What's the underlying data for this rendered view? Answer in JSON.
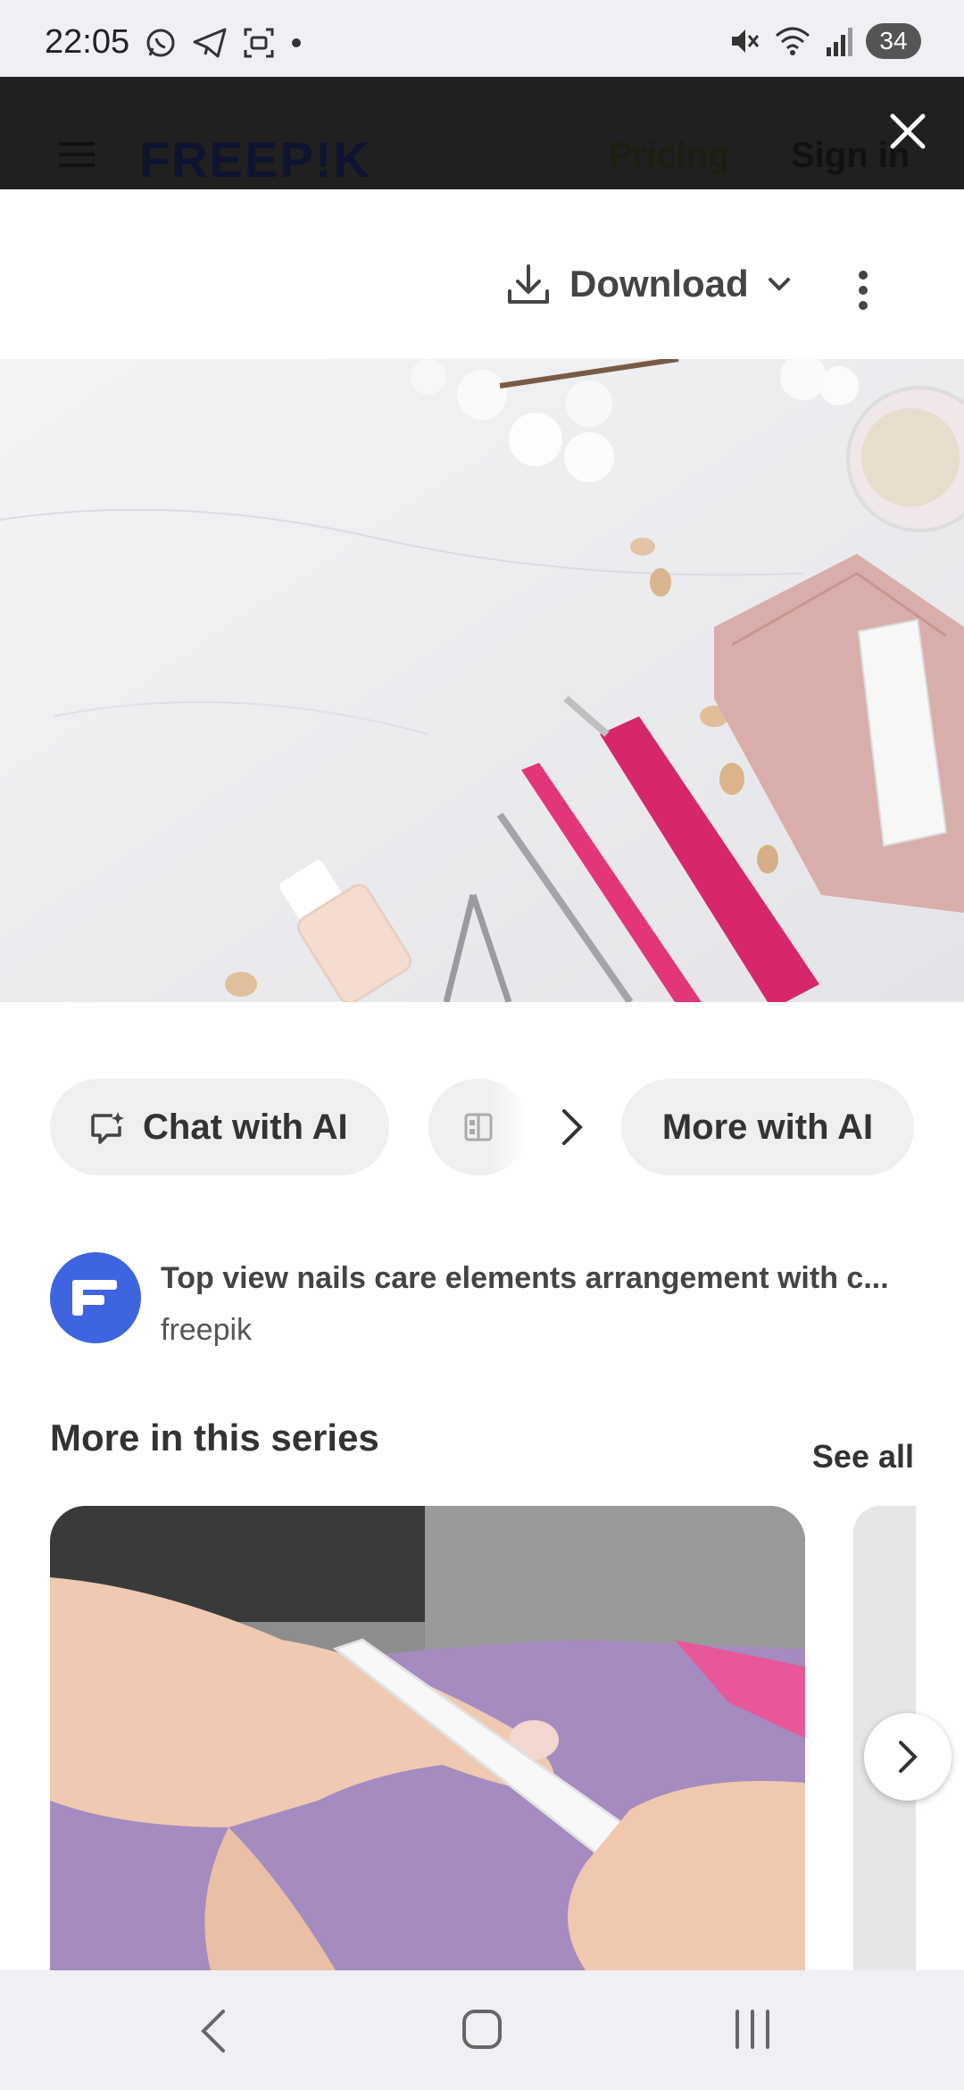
{
  "status_bar": {
    "time": "22:05",
    "battery": "34",
    "left_icons": [
      "whatsapp-icon",
      "telegram-icon",
      "screenshot-icon",
      "dot-icon"
    ],
    "right_icons": [
      "mute-icon",
      "wifi-icon",
      "signal-icon"
    ]
  },
  "header": {
    "brand": "FREEP!K",
    "pricing": "Pricing",
    "sign_in": "Sign in"
  },
  "toolbar": {
    "download_label": "Download"
  },
  "ai_actions": {
    "chat_label": "Chat with AI",
    "more_label": "More with AI"
  },
  "author": {
    "title": "Top view nails care elements arrangement with c...",
    "name": "freepik"
  },
  "series": {
    "title": "More in this series",
    "see_all": "See all"
  },
  "colors": {
    "accent_pink": "#e2357a",
    "avatar_blue": "#3e64e0",
    "chip_bg": "#efefef"
  }
}
